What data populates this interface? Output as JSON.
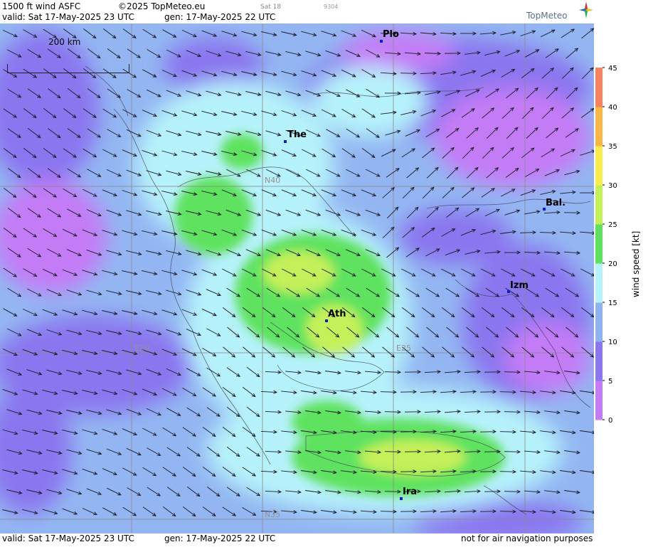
{
  "header": {
    "product": "1500 ft wind ASFC",
    "copyright": "©2025 TopMeteo.eu",
    "valid": "valid:  Sat  17-May-2025  23 UTC",
    "generated": "gen: 17-May-2025 22 UTC",
    "day_tag": "Sat 18",
    "code_tag": "9304",
    "brand": "TopMeteo"
  },
  "map": {
    "scale_label": "200 km",
    "grid_labels": {
      "lat40": "N40",
      "lat35": "N35",
      "lon20": "E20",
      "lon25": "E25"
    },
    "cities": [
      {
        "label": "Plo"
      },
      {
        "label": "The"
      },
      {
        "label": "Bal."
      },
      {
        "label": "Izm"
      },
      {
        "label": "Ath"
      },
      {
        "label": "Ira"
      }
    ]
  },
  "footer": {
    "valid": "valid:  Sat  17-May-2025  23 UTC",
    "generated": "gen: 17-May-2025 22 UTC",
    "disclaimer": "not for air navigation purposes"
  },
  "legend": {
    "title": "wind  speed  [kt]",
    "ticks": [
      "0",
      "5",
      "10",
      "15",
      "20",
      "25",
      "30",
      "35",
      "40",
      "45"
    ],
    "colors": [
      "#c47cf6",
      "#8a76ef",
      "#8fb2f0",
      "#b6f2fb",
      "#5ee25e",
      "#c4f05a",
      "#f8ed4c",
      "#fbb648",
      "#f88160"
    ]
  }
}
